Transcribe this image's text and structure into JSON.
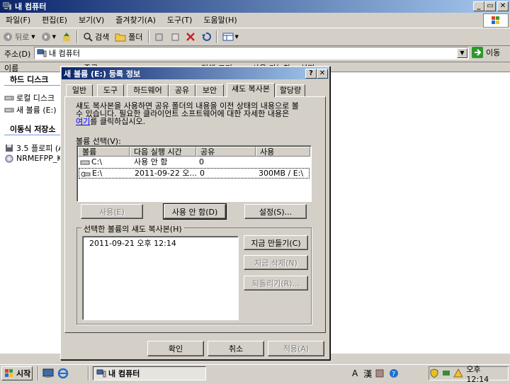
{
  "window": {
    "title": "내 컴퓨터",
    "caption_buttons": {
      "minimize": "_",
      "restore": "▭",
      "close": "✕"
    }
  },
  "menu": [
    "파일(F)",
    "편집(E)",
    "보기(V)",
    "즐겨찾기(A)",
    "도구(T)",
    "도움말(H)"
  ],
  "toolbar": {
    "back_label": "뒤로",
    "search_label": "검색",
    "folders_label": "폴더"
  },
  "address": {
    "label": "주소(D)",
    "value": "내 컴퓨터",
    "go_label": "이동"
  },
  "explorer": {
    "column_name": "이름",
    "column_type": "종류",
    "column_total": "전체 크기",
    "column_free": "사용 가능한",
    "column_comment": "설명",
    "section_hdd": "하드 디스크",
    "section_removable": "이동식 저장소",
    "items": [
      "로컬 디스크",
      "새 볼륨 (E:)",
      "3.5 플로피 (A",
      "NRMEFPP_K"
    ]
  },
  "dialog": {
    "title": "새 볼륨 (E:) 등록 정보",
    "help_btn": "?",
    "close_btn": "✕",
    "tabs": [
      "일반",
      "도구",
      "하드웨어",
      "공유",
      "보안",
      "섀도 복사본",
      "할당량"
    ],
    "description_line1": "섀도 복사본을 사용하면 공유 폴더의 내용을 이전 상태의 내용으로 볼",
    "description_line2": "수 있습니다. 필요한 클라이언트 소프트웨어에 대한 자세한 내용은",
    "link_text": "여기",
    "description_line3": "를 클릭하십시오.",
    "volume_select_label": "볼륨 선택(V):",
    "volume_columns": [
      "볼륨",
      "다음 실행 시간",
      "공유",
      "사용"
    ],
    "volumes": [
      {
        "name": "C:\\",
        "next_run": "사용 안 함",
        "shares": "0",
        "used": ""
      },
      {
        "name": "E:\\",
        "next_run": "2011-09-22 오...",
        "shares": "0",
        "used": "300MB / E:\\"
      }
    ],
    "enable_btn": "사용(E)",
    "disable_btn": "사용 안 함(D)",
    "settings_btn": "설정(S)...",
    "snapshots_group_label": "선택한 볼륨의 섀도 복사본(H)",
    "snapshots": [
      "2011-09-21 오후 12:14"
    ],
    "create_now_btn": "지금 만들기(C)",
    "delete_now_btn": "지금 삭제(N)",
    "revert_btn": "되돌리기(R)...",
    "ok_btn": "확인",
    "cancel_btn": "취소",
    "apply_btn": "적용(A)"
  },
  "taskbar": {
    "start_label": "시작",
    "task_label": "내 컴퓨터",
    "ime_mode": "A",
    "ime_hanja": "漢",
    "clock": "오후 12:14"
  },
  "colors": {
    "title_active": "#0a246a",
    "title_gradient_end": "#a6caf0",
    "face": "#d4d0c8",
    "link": "#0000ff"
  }
}
